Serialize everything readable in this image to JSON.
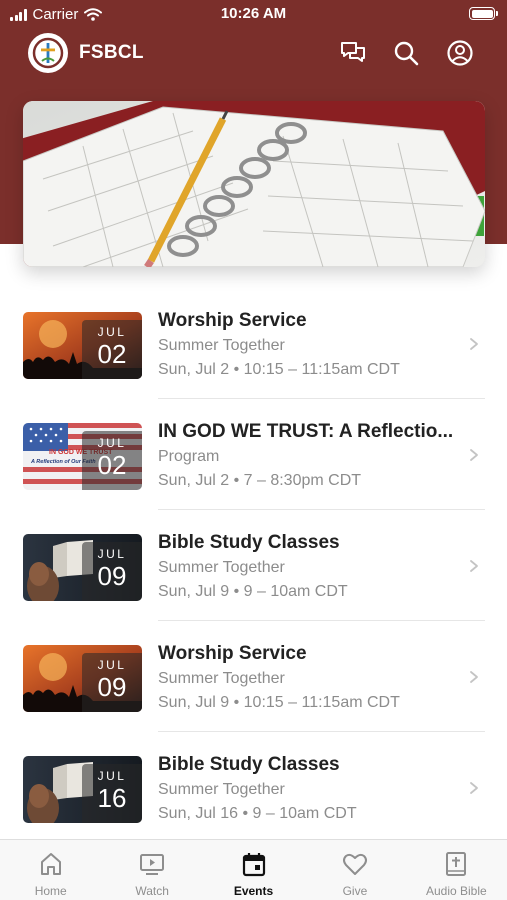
{
  "status_bar": {
    "carrier": "Carrier",
    "time": "10:26 AM"
  },
  "app": {
    "title": "FSBCL"
  },
  "header_icons": {
    "chat": "chat-icon",
    "search": "search-icon",
    "profile": "profile-icon"
  },
  "colors": {
    "header": "#7b2f2b",
    "text_primary": "#222222",
    "text_secondary": "#8c8c8c",
    "tab_inactive": "#8e8e8e",
    "tab_active": "#111111"
  },
  "events": [
    {
      "month": "JUL",
      "day": "02",
      "title": "Worship Service",
      "subtitle": "Summer Together",
      "time": "Sun, Jul 2 • 10:15 – 11:15am CDT",
      "thumb": "worship"
    },
    {
      "month": "JUL",
      "day": "02",
      "title": "IN GOD WE TRUST: A Reflectio...",
      "subtitle": "Program",
      "time": "Sun, Jul 2 • 7 – 8:30pm CDT",
      "thumb": "flag",
      "thumb_text_1": "IN GOD WE TRUST",
      "thumb_text_2": "A Reflection of Our Faith"
    },
    {
      "month": "JUL",
      "day": "09",
      "title": "Bible Study Classes",
      "subtitle": "Summer Together",
      "time": "Sun, Jul 9 • 9 – 10am CDT",
      "thumb": "bible"
    },
    {
      "month": "JUL",
      "day": "09",
      "title": "Worship Service",
      "subtitle": "Summer Together",
      "time": "Sun, Jul 9 • 10:15 – 11:15am CDT",
      "thumb": "worship"
    },
    {
      "month": "JUL",
      "day": "16",
      "title": "Bible Study Classes",
      "subtitle": "Summer Together",
      "time": "Sun, Jul 16 • 9 – 10am CDT",
      "thumb": "bible"
    }
  ],
  "tabs": [
    {
      "label": "Home",
      "icon": "home-icon",
      "active": false
    },
    {
      "label": "Watch",
      "icon": "watch-icon",
      "active": false
    },
    {
      "label": "Events",
      "icon": "calendar-icon",
      "active": true
    },
    {
      "label": "Give",
      "icon": "heart-icon",
      "active": false
    },
    {
      "label": "Audio Bible",
      "icon": "bible-icon",
      "active": false
    }
  ]
}
